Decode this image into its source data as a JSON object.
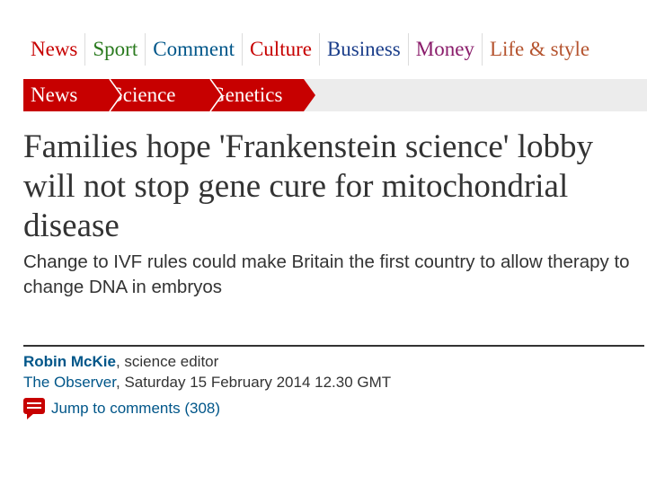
{
  "top_nav": [
    {
      "label": "News",
      "color": "#c70000"
    },
    {
      "label": "Sport",
      "color": "#2a7a1e"
    },
    {
      "label": "Comment",
      "color": "#005689"
    },
    {
      "label": "Culture",
      "color": "#c70000"
    },
    {
      "label": "Business",
      "color": "#1b3e8a"
    },
    {
      "label": "Money",
      "color": "#8a1d6b"
    },
    {
      "label": "Life & style",
      "color": "#b5542f"
    }
  ],
  "breadcrumbs": [
    "News",
    "Science",
    "Genetics"
  ],
  "article": {
    "headline": "Families hope 'Frankenstein science' lobby will not stop gene cure for mitochondrial disease",
    "standfirst": "Change to IVF rules could make Britain the first country to allow therapy to change DNA in embryos",
    "author": "Robin McKie",
    "author_role": ", science editor",
    "publication": "The Observer",
    "date": ", Saturday 15 February 2014 12.30 GMT",
    "comments_link": "Jump to comments (308)"
  },
  "icons": {
    "comments": "speech-bubble-icon"
  },
  "colors": {
    "brand_red": "#c70000",
    "link_blue": "#005689",
    "breadcrumb_bar": "#ececec"
  }
}
